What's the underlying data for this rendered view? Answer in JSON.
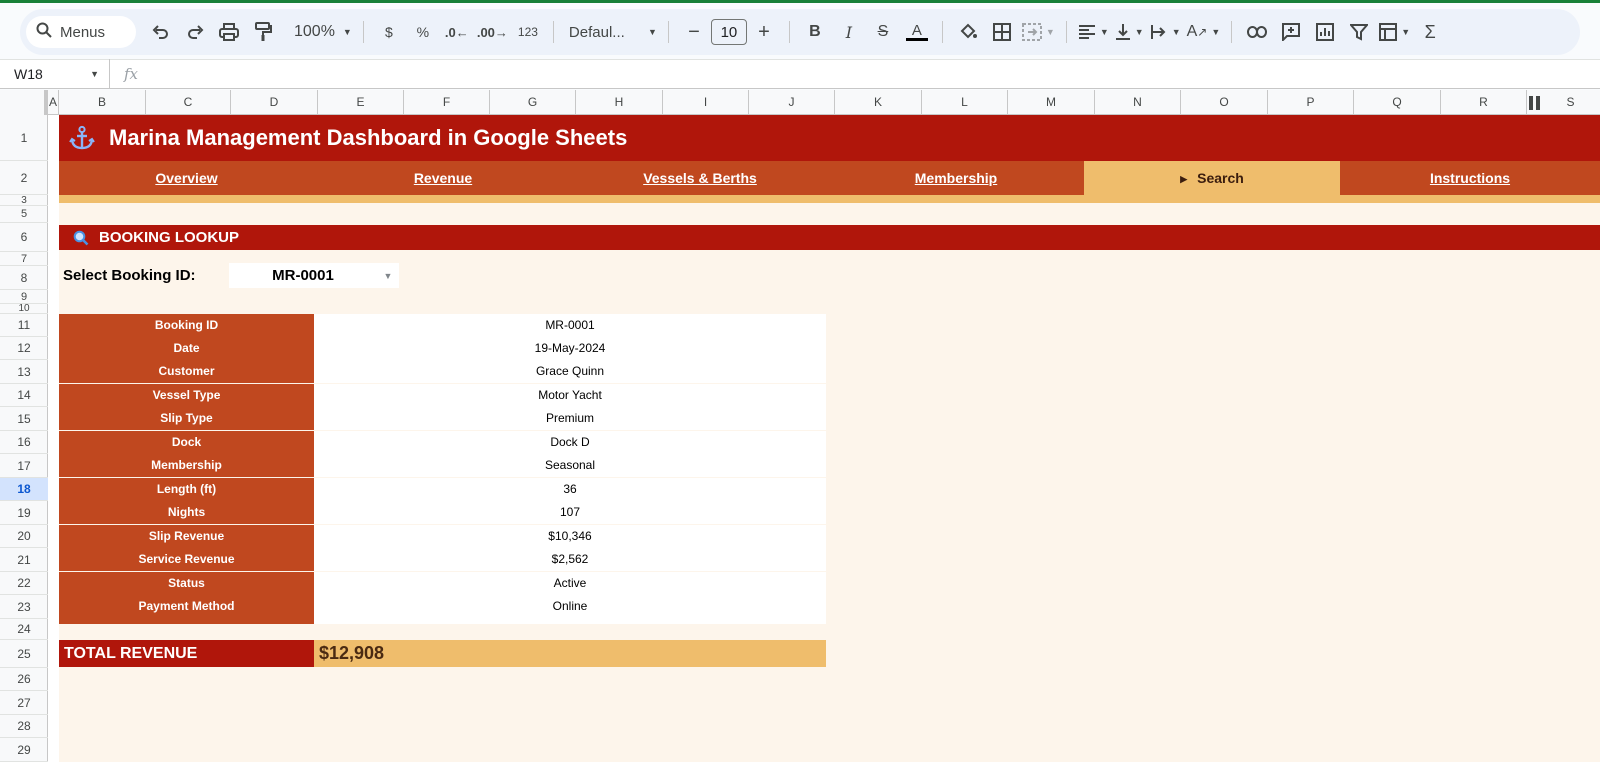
{
  "toolbar": {
    "menus_label": "Menus",
    "zoom": "100%",
    "currency": "$",
    "percent": "%",
    "decimal_decrease": ".0",
    "decimal_increase": ".00",
    "number_format": "123",
    "font": "Defaul...",
    "font_size": "10"
  },
  "formula_bar": {
    "cell_ref": "W18",
    "fx": "fx"
  },
  "columns": [
    "A",
    "B",
    "C",
    "D",
    "E",
    "F",
    "G",
    "H",
    "I",
    "J",
    "K",
    "L",
    "M",
    "N",
    "O",
    "P",
    "Q",
    "R",
    "S"
  ],
  "rows": [
    "1",
    "2",
    "3",
    "5",
    "6",
    "7",
    "8",
    "9",
    "10",
    "11",
    "12",
    "13",
    "14",
    "15",
    "16",
    "17",
    "18",
    "19",
    "20",
    "21",
    "22",
    "23",
    "24",
    "25",
    "26",
    "27",
    "28",
    "29"
  ],
  "active_row": "18",
  "dashboard": {
    "title": "Marina Management Dashboard in Google Sheets",
    "nav": [
      "Overview",
      "Revenue",
      "Vessels & Berths",
      "Membership",
      "Search",
      "Instructions"
    ],
    "active_nav": "Search",
    "section_title": "BOOKING LOOKUP",
    "select_label": "Select Booking ID:",
    "selected_id": "MR-0001",
    "details": [
      {
        "label": "Booking ID",
        "value": "MR-0001"
      },
      {
        "label": "Date",
        "value": "19-May-2024"
      },
      {
        "label": "Customer",
        "value": "Grace Quinn"
      },
      {
        "label": "Vessel Type",
        "value": "Motor Yacht"
      },
      {
        "label": "Slip Type",
        "value": "Premium"
      },
      {
        "label": "Dock",
        "value": "Dock D"
      },
      {
        "label": "Membership",
        "value": "Seasonal"
      },
      {
        "label": "Length (ft)",
        "value": "36"
      },
      {
        "label": "Nights",
        "value": "107"
      },
      {
        "label": "Slip Revenue",
        "value": "$10,346"
      },
      {
        "label": "Service Revenue",
        "value": "$2,562"
      },
      {
        "label": "Status",
        "value": "Active"
      },
      {
        "label": "Payment Method",
        "value": "Online"
      }
    ],
    "total_label": "TOTAL REVENUE",
    "total_value": "$12,908"
  },
  "colors": {
    "title_red": "#b0160b",
    "nav_orange": "#c0481f",
    "gold": "#efbd6c",
    "cream": "#fdf5eb"
  }
}
